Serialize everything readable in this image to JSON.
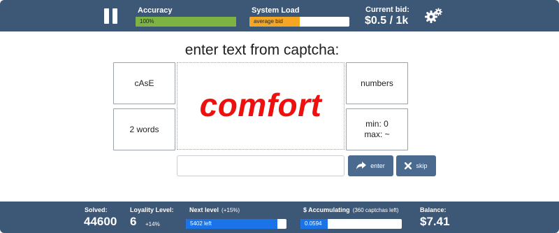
{
  "header": {
    "pause_icon": "pause-icon",
    "accuracy": {
      "label": "Accuracy",
      "bar_text": "100%",
      "fill_fraction": 1.0,
      "color": "#7cb342"
    },
    "system_load": {
      "label": "System Load",
      "bar_text": "average bid",
      "fill_fraction": 0.5,
      "color": "#f5a623"
    },
    "current_bid": {
      "label": "Current bid:",
      "value": "$0.5 / 1k"
    },
    "settings_icon": "gear-icon"
  },
  "main": {
    "title": "enter text from captcha:",
    "captcha_word": "comfort",
    "captcha_color": "#ee0f0f",
    "options": {
      "case": "cAsE",
      "words": "2 words",
      "numbers": "numbers",
      "min": "min: 0",
      "max": "max: ~"
    },
    "answer_value": "",
    "enter_label": "enter",
    "skip_label": "skip"
  },
  "footer": {
    "solved": {
      "label": "Solved:",
      "value": "44600"
    },
    "loyalty": {
      "label": "Loyality Level:",
      "value": "6",
      "bonus": "+14%"
    },
    "next_level": {
      "label": "Next level",
      "percent": "(+15%)",
      "bar_text": "5402 left",
      "fill_fraction": 0.91
    },
    "accumulating": {
      "label": "$ Accumulating",
      "note": "(360 captchas left)",
      "bar_text": "0.0594",
      "fill_fraction": 0.27
    },
    "balance": {
      "label": "Balance:",
      "value": "$7.41"
    }
  },
  "colors": {
    "bar_bg": "#3d5776",
    "button": "#4b6a8f",
    "progress_blue": "#1a73e8"
  }
}
